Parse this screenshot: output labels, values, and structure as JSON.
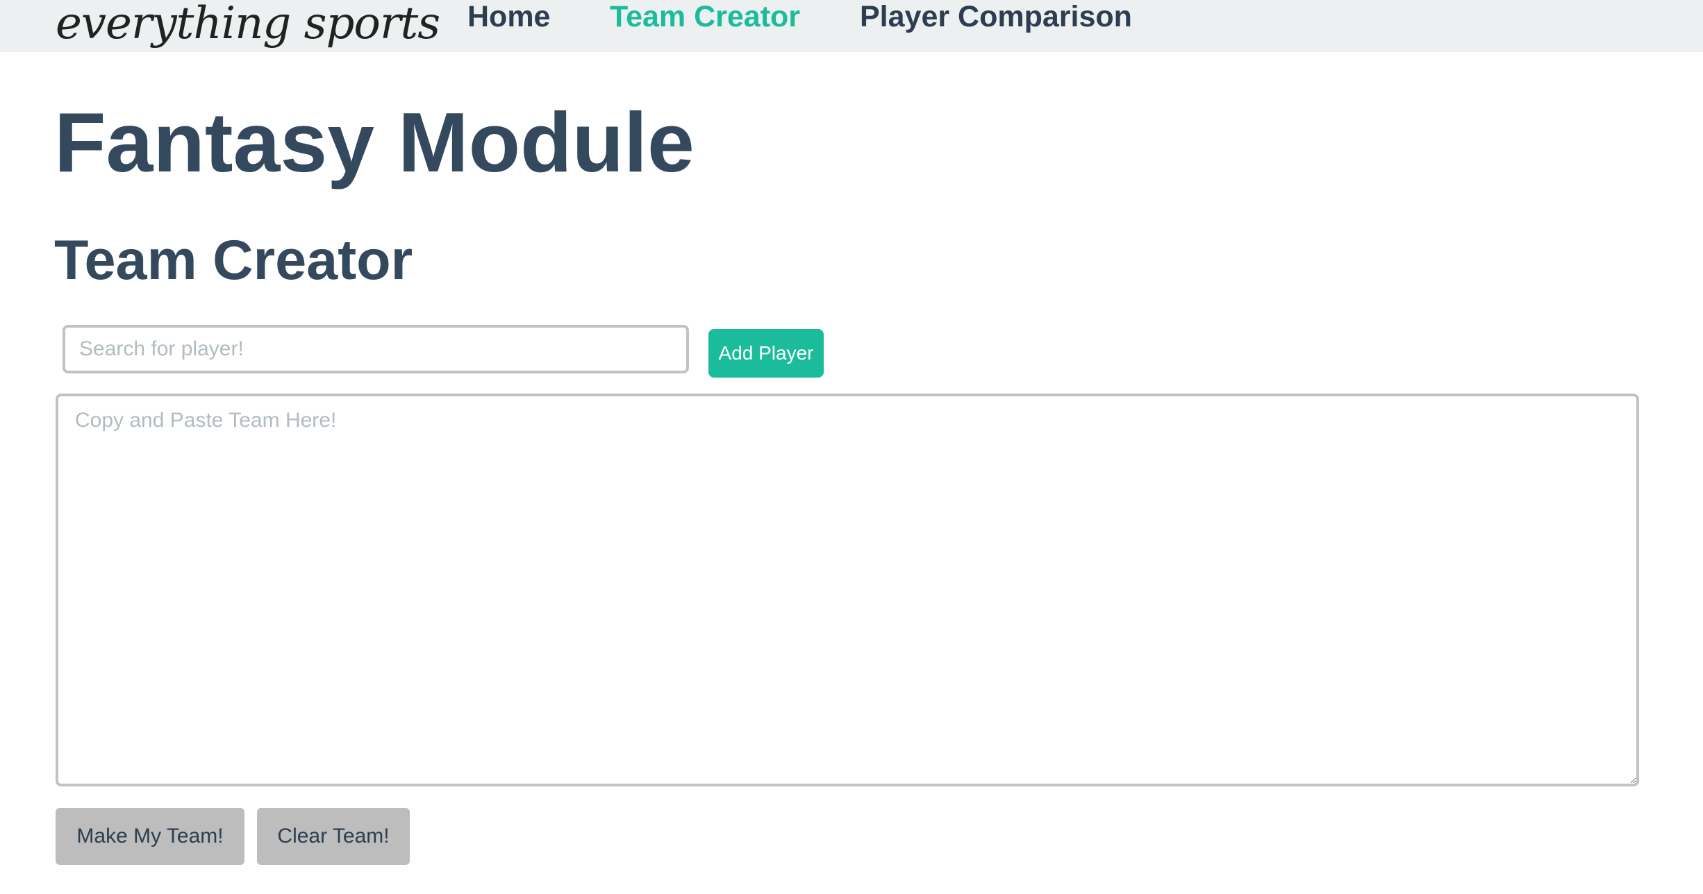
{
  "navbar": {
    "brand": "everything sports",
    "links": [
      {
        "label": "Home",
        "active": false
      },
      {
        "label": "Team Creator",
        "active": true
      },
      {
        "label": "Player Comparison",
        "active": false
      }
    ]
  },
  "main": {
    "title": "Fantasy Module",
    "section_title": "Team Creator",
    "search": {
      "placeholder": "Search for player!",
      "value": ""
    },
    "add_button_label": "Add Player",
    "team_textarea": {
      "placeholder": "Copy and Paste Team Here!",
      "value": ""
    },
    "make_team_label": "Make My Team!",
    "clear_team_label": "Clear Team!"
  },
  "colors": {
    "accent": "#1abc9c",
    "text_dark": "#2c3e50",
    "navbar_bg": "#ecf0f1",
    "button_gray": "#bdbdbd",
    "border": "#bdc3c7"
  }
}
